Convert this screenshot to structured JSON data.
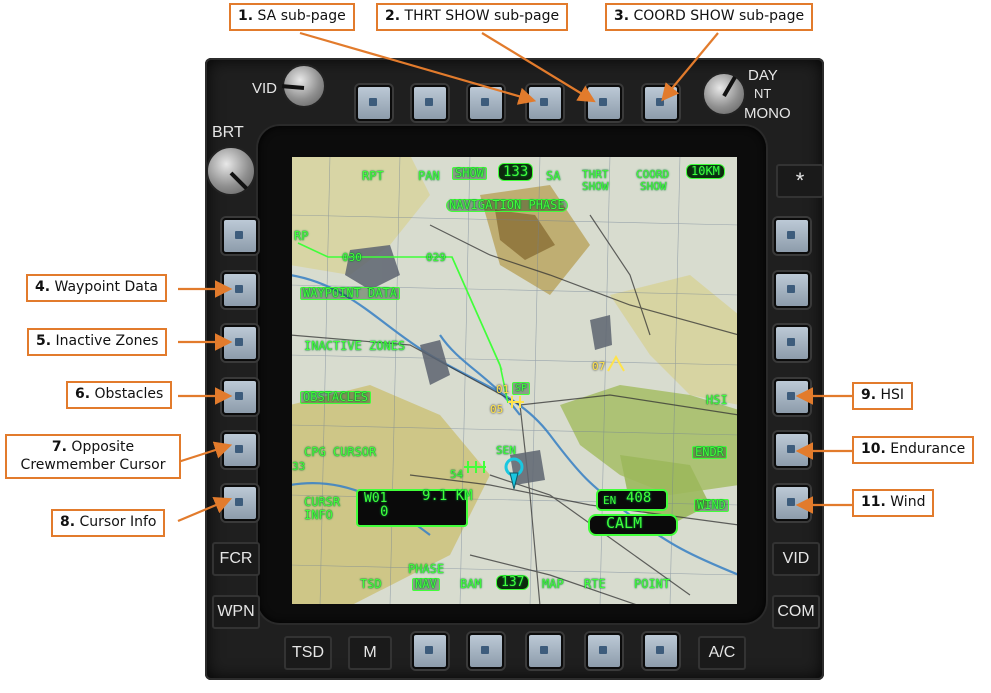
{
  "callouts": [
    {
      "num": "1.",
      "text": "SA sub-page"
    },
    {
      "num": "2.",
      "text": "THRT SHOW sub-page"
    },
    {
      "num": "3.",
      "text": "COORD SHOW sub-page"
    },
    {
      "num": "4.",
      "text": "Waypoint Data"
    },
    {
      "num": "5.",
      "text": "Inactive Zones"
    },
    {
      "num": "6.",
      "text": "Obstacles"
    },
    {
      "num": "7.",
      "text": "Opposite",
      "text2": "Crewmember Cursor"
    },
    {
      "num": "8.",
      "text": "Cursor Info"
    },
    {
      "num": "9.",
      "text": "HSI"
    },
    {
      "num": "10.",
      "text": "Endurance"
    },
    {
      "num": "11.",
      "text": "Wind"
    }
  ],
  "bezel": {
    "vid_knob": "VID",
    "brt_knob": "BRT",
    "mode_day": "DAY",
    "mode_nt": "NT",
    "mode_mono": "MONO",
    "asterisk": "*",
    "left_fixed": [
      "FCR",
      "WPN"
    ],
    "right_fixed": [
      "VID",
      "COM"
    ],
    "bottom_fixed": [
      "TSD",
      "M",
      "A/C"
    ]
  },
  "display": {
    "top": {
      "rpt": "RPT",
      "pan": "PAN",
      "show": "SHOW",
      "heading": "133",
      "sa": "SA",
      "thrt1": "THRT",
      "thrt2": "SHOW",
      "coord1": "COORD",
      "coord2": "SHOW",
      "scale": "10KM"
    },
    "phase_banner": "NAVIGATION PHASE",
    "left": {
      "rp": "RP",
      "wpt_data": "WAYPOINT DATA",
      "inactive": "INACTIVE ZONES",
      "obstacles": "OBSTACLES",
      "cpg_cursor": "CPG CURSOR",
      "cursor1": "CURSR",
      "cursor2": "INFO"
    },
    "right": {
      "hsi": "HSI",
      "endr": "ENDR",
      "wind": "WIND"
    },
    "cursor_info": {
      "wpt": "W01",
      "dist": "9.1 KM",
      "value": "0"
    },
    "endurance": {
      "en": "EN",
      "val": "408"
    },
    "wind": "CALM",
    "bottom": {
      "tsd": "TSD",
      "phase": "PHASE",
      "nav": "NAV",
      "bam": "BAM",
      "heading": "137",
      "map": "MAP",
      "rte": "RTE",
      "point": "POINT"
    },
    "map_labels": {
      "w030": "030",
      "w029": "029",
      "sp01": "01",
      "sp": "SP",
      "w05": "05",
      "w07": "07",
      "sen": "SEN",
      "w54": "54",
      "w33": "33"
    }
  }
}
